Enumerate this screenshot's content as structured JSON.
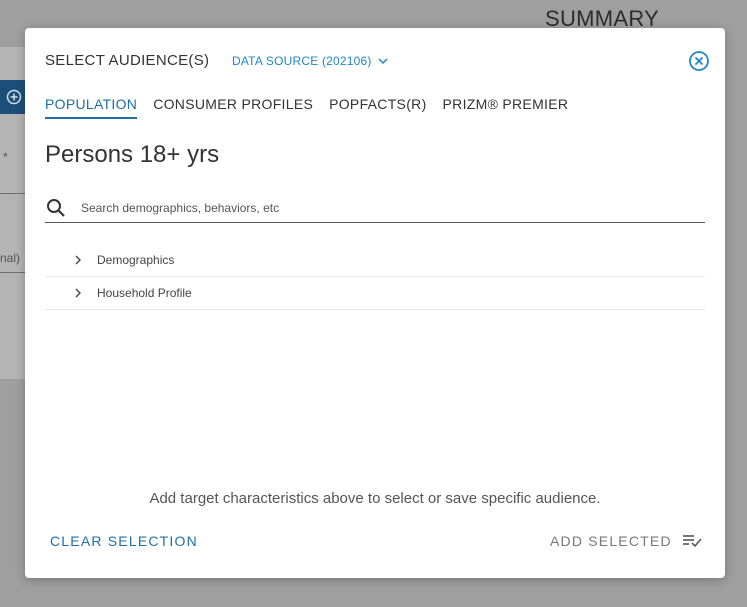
{
  "background": {
    "summary_title": "SUMMARY",
    "asterisk": "*",
    "partial_label": "nal)"
  },
  "modal": {
    "title": "SELECT AUDIENCE(S)",
    "data_source_label": "DATA SOURCE (202106)",
    "tabs": [
      {
        "label": "POPULATION",
        "active": true
      },
      {
        "label": "CONSUMER PROFILES",
        "active": false
      },
      {
        "label": "POPFACTS(R)",
        "active": false
      },
      {
        "label": "PRIZM® PREMIER",
        "active": false
      }
    ],
    "heading": "Persons 18+ yrs",
    "search": {
      "placeholder": "Search demographics, behaviors, etc",
      "value": ""
    },
    "tree_items": [
      {
        "label": "Demographics"
      },
      {
        "label": "Household Profile"
      }
    ],
    "hint": "Add target characteristics above to select or save specific audience.",
    "clear_label": "CLEAR SELECTION",
    "add_label": "ADD SELECTED"
  },
  "colors": {
    "accent": "#1e6fa8",
    "link": "#1e87c8",
    "overlay": "#9f9f9f"
  },
  "icons": {
    "close": "close-circle-icon",
    "search": "search-icon",
    "chevron": "chevron-right-icon",
    "dropdown": "chevron-down-icon",
    "add": "playlist-add-check-icon",
    "plus": "plus-circle-icon"
  }
}
